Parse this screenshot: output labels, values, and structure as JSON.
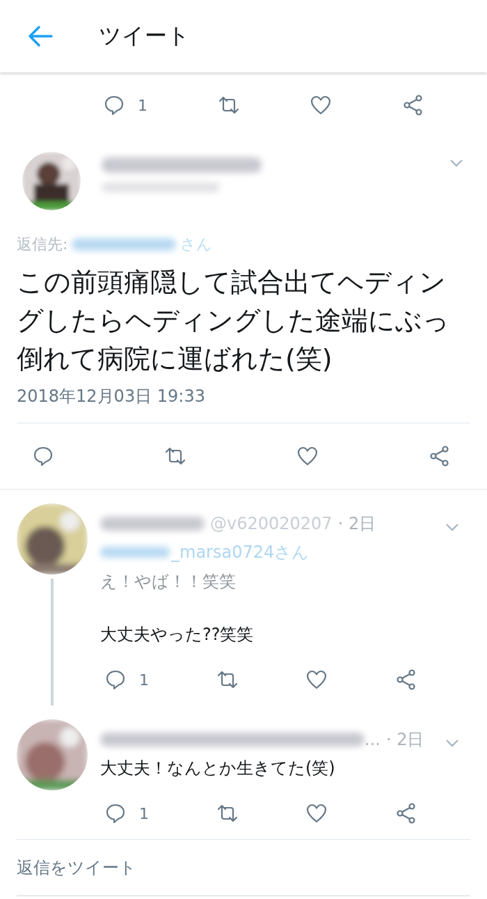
{
  "header": {
    "title": "ツイート"
  },
  "top_actions": {
    "reply_count": "1"
  },
  "main_tweet": {
    "reply_to_label": "返信先:",
    "reply_to_suffix": "さん",
    "lines": [
      "この前頭痛隠して試合出てヘディン",
      "グしたらヘディングした途端にぶっ",
      "倒れて病院に運ばれた(笑)"
    ],
    "timestamp": "2018年12月03日 19:33"
  },
  "replies": [
    {
      "handle": "@v620020207",
      "time": "· 2日",
      "reply_to": "_marsa0724さん",
      "faded_line": "え！やば！！笑笑",
      "text": "大丈夫やった??笑笑",
      "reply_count": "1",
      "thread_line": true
    },
    {
      "handle_tail": "...",
      "time": "· 2日",
      "text": "大丈夫！なんとか生きてた(笑)",
      "reply_count": "1",
      "thread_line": false
    }
  ],
  "reply_field": {
    "placeholder": "返信をツイート"
  }
}
